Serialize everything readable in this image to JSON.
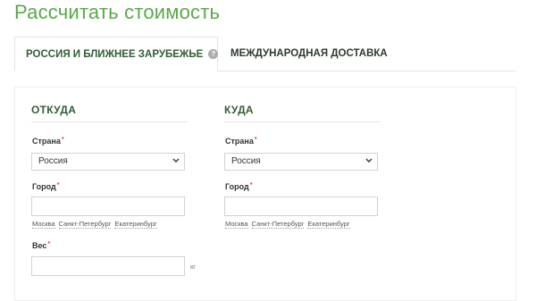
{
  "page": {
    "title": "Рассчитать стоимость"
  },
  "tabs": [
    {
      "label": "РОССИЯ И БЛИЖНЕЕ ЗАРУБЕЖЬЕ",
      "help": "?",
      "active": true
    },
    {
      "label": "МЕЖДУНАРОДНАЯ ДОСТАВКА",
      "active": false
    }
  ],
  "from": {
    "title": "ОТКУДА",
    "country_label": "Страна",
    "country_value": "Россия",
    "city_label": "Город",
    "city_value": "",
    "quick_cities": [
      "Москва",
      "Санкт-Петербург",
      "Екатеринбург"
    ],
    "weight_label": "Вес",
    "weight_value": "",
    "weight_unit": "кг"
  },
  "to": {
    "title": "КУДА",
    "country_label": "Страна",
    "country_value": "Россия",
    "city_label": "Город",
    "city_value": "",
    "quick_cities": [
      "Москва",
      "Санкт-Петербург",
      "Екатеринбург"
    ]
  },
  "required_mark": "*",
  "colors": {
    "accent": "#5aa84a",
    "heading": "#2f5e33",
    "required": "#d33a3a"
  }
}
